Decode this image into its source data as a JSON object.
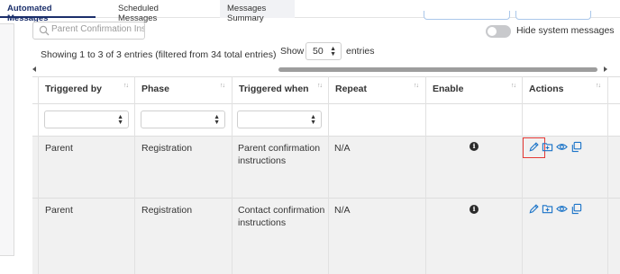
{
  "tabs": [
    {
      "label": "Automated Messages",
      "active": true
    },
    {
      "label": "Scheduled Messages",
      "active": false
    },
    {
      "label": "Messages Summary",
      "active": false
    }
  ],
  "search": {
    "placeholder": "Parent Confirmation Ins"
  },
  "toggle": {
    "label": "Hide system messages",
    "on": false
  },
  "info": "Showing 1 to 3 of 3 entries (filtered from 34 total entries)",
  "length": {
    "show_label": "Show",
    "value": "50",
    "entries_label": "entries"
  },
  "table": {
    "columns": [
      "Triggered by",
      "Phase",
      "Triggered when",
      "Repeat",
      "Enable",
      "Actions"
    ],
    "rows": [
      {
        "triggered_by": "Parent",
        "phase": "Registration",
        "triggered_when_1": "Parent confirmation",
        "triggered_when_2": "instructions",
        "repeat": "N/A"
      },
      {
        "triggered_by": "Parent",
        "phase": "Registration",
        "triggered_when_1": "Contact confirmation",
        "triggered_when_2": "instructions",
        "repeat": "N/A"
      }
    ]
  },
  "icons": {
    "search": "search-icon",
    "edit": "pencil-icon",
    "copy_to_folder": "folder-plus-icon",
    "preview": "eye-icon",
    "duplicate": "copy-icon",
    "info": "info-icon"
  },
  "colors": {
    "accent": "#1a73c8",
    "tab_active": "#1b2f6b",
    "highlight": "#e53935"
  }
}
